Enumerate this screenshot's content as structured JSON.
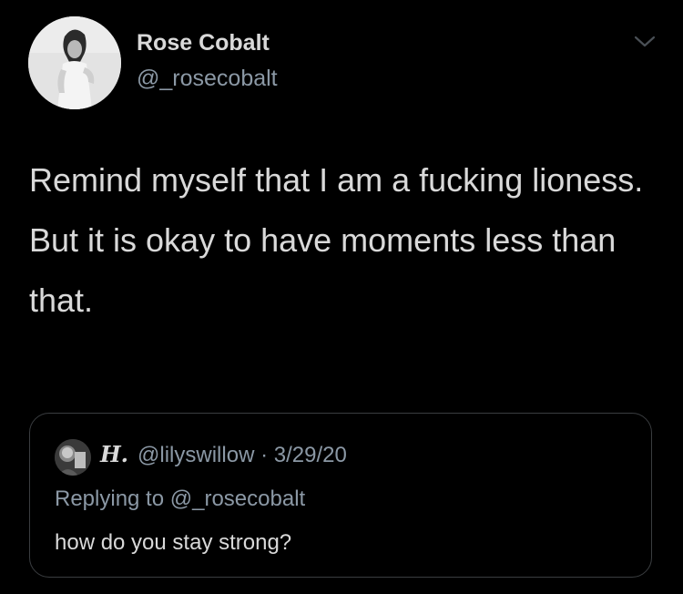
{
  "tweet": {
    "author": {
      "name": "Rose Cobalt",
      "handle": "@_rosecobalt"
    },
    "text_lines": [
      "Remind myself that I am a fucking lioness.",
      "But it is okay to have moments less than that."
    ]
  },
  "quoted_tweet": {
    "name": "H.",
    "handle": "@lilyswillow",
    "separator": "·",
    "date": "3/29/20",
    "replying_to_label": "Replying to",
    "replying_to_handle": "@_rosecobalt",
    "text": "how do you stay strong?"
  },
  "icons": {
    "menu": "chevron-down-icon"
  },
  "colors": {
    "background": "#000000",
    "primary_text": "#d9d9d9",
    "secondary_text": "#8b98a5",
    "border": "#3a3d40"
  }
}
